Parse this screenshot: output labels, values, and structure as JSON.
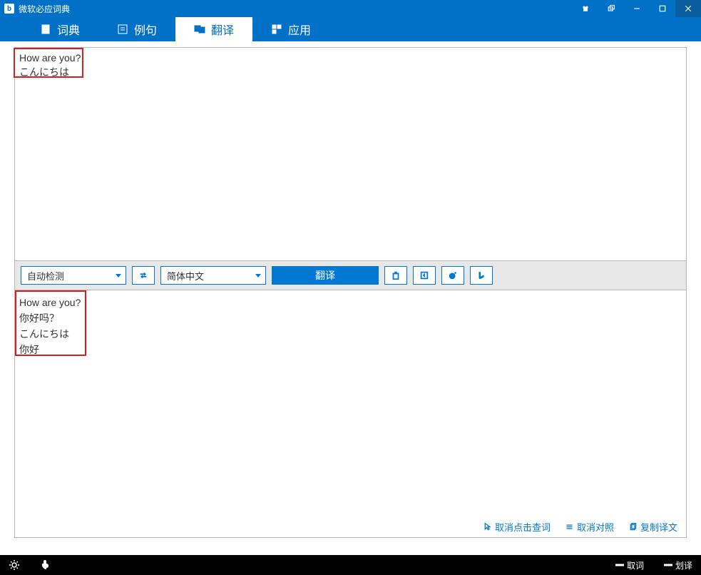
{
  "app": {
    "title": "微软必应词典"
  },
  "tabs": [
    {
      "label": "词典",
      "active": false
    },
    {
      "label": "例句",
      "active": false
    },
    {
      "label": "翻译",
      "active": true
    },
    {
      "label": "应用",
      "active": false
    }
  ],
  "input": {
    "line1": "How are you?",
    "line2": "こんにちは"
  },
  "toolbar": {
    "source_lang": "自动检测",
    "target_lang": "简体中文",
    "translate_label": "翻译"
  },
  "output": {
    "line1": "How are you?",
    "line2": "你好吗？",
    "line3": "こんにちは",
    "line4": "你好"
  },
  "output_links": {
    "cancel_click_lookup": "取消点击查词",
    "cancel_compare": "取消对照",
    "copy_translation": "复制译文"
  },
  "status": {
    "pick_word": "取词",
    "stroke_translate": "划译"
  }
}
